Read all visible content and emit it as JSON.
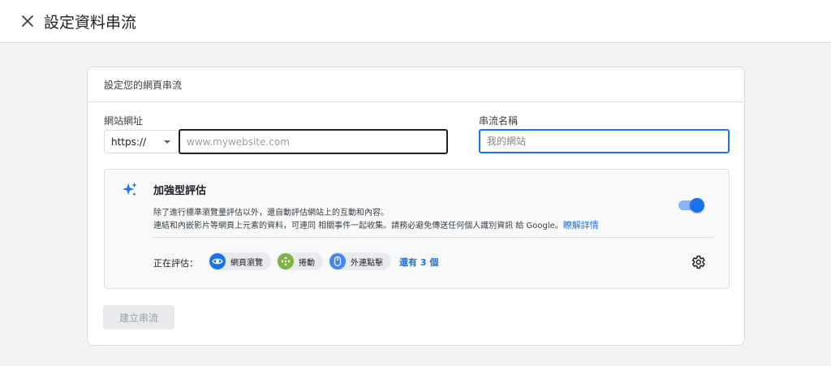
{
  "header": {
    "title": "設定資料串流"
  },
  "card": {
    "heading": "設定您的網頁串流",
    "url_label": "網站網址",
    "protocol": "https://",
    "url_placeholder": "www.mywebsite.com",
    "name_label": "串流名稱",
    "name_placeholder": "我的網站"
  },
  "enhanced": {
    "title": "加強型評估",
    "desc1": "除了進行標準瀏覽量評估以外，還自動評估網站上的互動和內容。",
    "desc2": "連結和內嵌影片等網頁上元素的資料，可連同 相關事件一起收集。請務必避免傳送任何個人識別資訊 給 Google。",
    "learn_more": "瞭解詳情",
    "toggle_on": true,
    "measuring_label": "正在評估：",
    "chips": [
      {
        "label": "網頁瀏覽",
        "icon": "eye-icon",
        "color": "#1a73e8"
      },
      {
        "label": "捲動",
        "icon": "scroll-icon",
        "color": "#7cb342"
      },
      {
        "label": "外連點擊",
        "icon": "mouse-icon",
        "color": "#4285f4"
      }
    ],
    "more": "還有 3 個"
  },
  "actions": {
    "create_label": "建立串流"
  }
}
